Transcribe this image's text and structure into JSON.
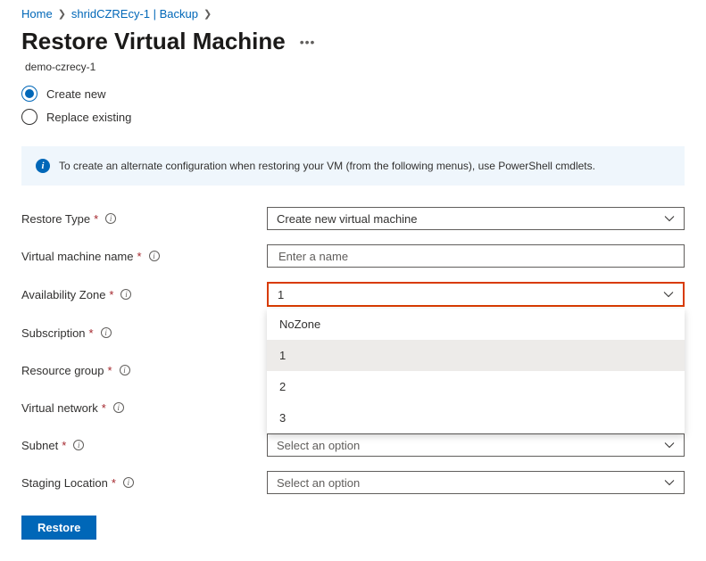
{
  "breadcrumb": {
    "items": [
      "Home",
      "shridCZREcy-1 | Backup"
    ]
  },
  "page": {
    "title": "Restore Virtual Machine",
    "subtitle": "demo-czrecy-1"
  },
  "radios": {
    "create_new": "Create new",
    "replace_existing": "Replace existing",
    "selected": "create_new"
  },
  "info": {
    "text": "To create an alternate configuration when restoring your VM (from the following menus), use PowerShell cmdlets."
  },
  "fields": {
    "restore_type": {
      "label": "Restore Type",
      "value": "Create new virtual machine"
    },
    "vm_name": {
      "label": "Virtual machine name",
      "placeholder": "Enter a name",
      "value": ""
    },
    "availability_zone": {
      "label": "Availability Zone",
      "value": "1",
      "options": [
        "NoZone",
        "1",
        "2",
        "3"
      ]
    },
    "subscription": {
      "label": "Subscription"
    },
    "resource_group": {
      "label": "Resource group"
    },
    "virtual_network": {
      "label": "Virtual network"
    },
    "subnet": {
      "label": "Subnet",
      "value": "Select an option"
    },
    "staging_location": {
      "label": "Staging Location",
      "value": "Select an option"
    }
  },
  "buttons": {
    "restore": "Restore"
  }
}
